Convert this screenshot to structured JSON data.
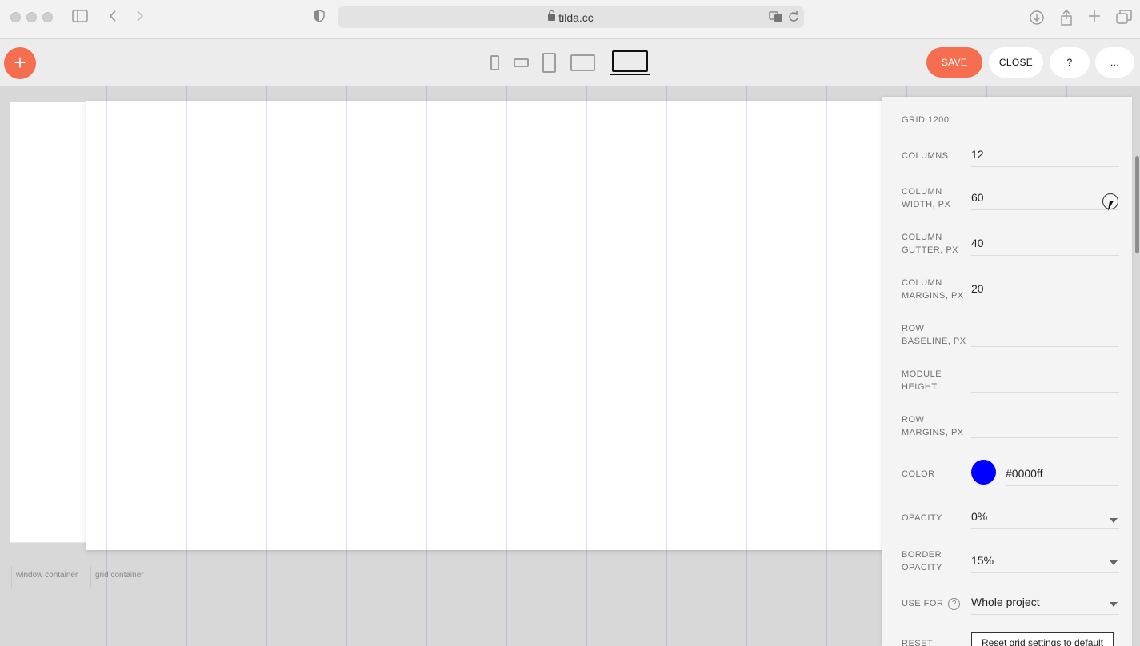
{
  "browser": {
    "url": "tilda.cc",
    "icons": [
      "sidebar-toggle-icon",
      "back-icon",
      "forward-icon",
      "shield-icon",
      "translate-icon",
      "reload-icon",
      "download-icon",
      "share-icon",
      "new-tab-icon",
      "tabs-overview-icon"
    ]
  },
  "toolbar": {
    "add_label": "+",
    "save_label": "SAVE",
    "close_label": "CLOSE",
    "help_label": "?",
    "more_label": "...",
    "active_device": "desktop-1200",
    "accent_color": "#f46e4f"
  },
  "canvas": {
    "window_container_label": "window container",
    "grid_container_label": "grid container",
    "grid_line_color": "#0000ff"
  },
  "panel": {
    "title": "GRID 1200",
    "columns": {
      "label": "COLUMNS",
      "value": "12"
    },
    "column_width": {
      "label1": "COLUMN",
      "label2": "WIDTH, PX",
      "value": "60"
    },
    "column_gutter": {
      "label1": "COLUMN",
      "label2": "GUTTER, PX",
      "value": "40"
    },
    "column_margins": {
      "label1": "COLUMN",
      "label2": "MARGINS, PX",
      "value": "20"
    },
    "row_baseline": {
      "label1": "ROW",
      "label2": "BASELINE, PX",
      "value": ""
    },
    "module_height": {
      "label1": "MODULE",
      "label2": "HEIGHT",
      "value": ""
    },
    "row_margins": {
      "label1": "ROW",
      "label2": "MARGINS, PX",
      "value": ""
    },
    "color": {
      "label": "COLOR",
      "value": "#0000ff",
      "swatch": "#0000ff"
    },
    "opacity": {
      "label": "OPACITY",
      "value": "0%"
    },
    "border_opacity": {
      "label1": "BORDER",
      "label2": "OPACITY",
      "value": "15%"
    },
    "use_for": {
      "label": "USE FOR",
      "help": "?",
      "value": "Whole project"
    },
    "reset": {
      "label": "RESET",
      "button": "Reset grid settings to default"
    }
  }
}
